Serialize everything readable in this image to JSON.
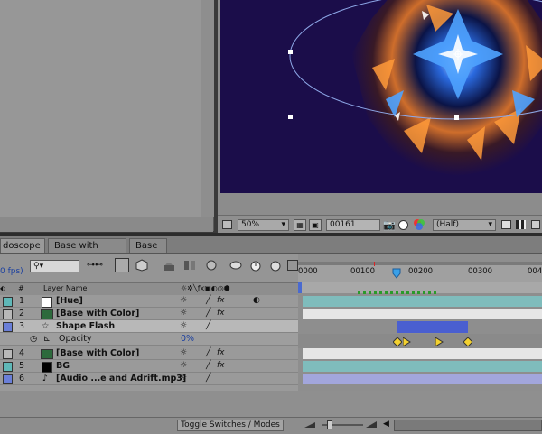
{
  "viewer": {
    "zoom": "50%",
    "timecode": "00161",
    "resolution": "(Half)"
  },
  "timeline": {
    "tabs": [
      {
        "label": "doscope",
        "active": true
      },
      {
        "label": "Base with Color",
        "active": false
      },
      {
        "label": "Base",
        "active": false
      }
    ],
    "fps_text": "0 fps)",
    "search_glyph": "⚲▾",
    "column_headers": {
      "number": "#",
      "layer_name": "Layer Name"
    },
    "ruler_ticks": [
      "0000",
      "00100",
      "00200",
      "00300",
      "004"
    ],
    "layers": [
      {
        "num": "1",
        "name": "[Hue]",
        "label_color": "#5fb8b8"
      },
      {
        "num": "2",
        "name": "[Base with Color]",
        "label_color": "#b8b8b8"
      },
      {
        "num": "3",
        "name": "Shape Flash",
        "label_color": "#6a7fd8",
        "selected": true
      },
      {
        "num": "4",
        "name": "[Base with Color]",
        "label_color": "#b8b8b8"
      },
      {
        "num": "5",
        "name": "BG",
        "label_color": "#5fb8b8"
      },
      {
        "num": "6",
        "name": "[Audio ...e and Adrift.mp3]",
        "label_color": "#6a7fd8"
      }
    ],
    "property": {
      "name": "Opacity",
      "value": "0%"
    },
    "toggle_label": "Toggle Switches / Modes"
  }
}
